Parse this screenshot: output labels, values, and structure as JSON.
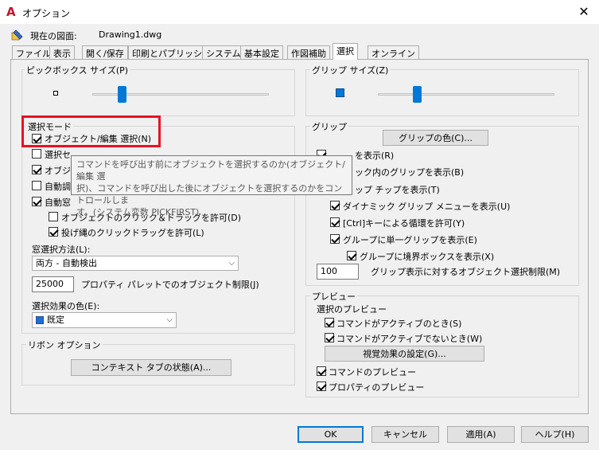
{
  "window": {
    "title": "オプション",
    "close_glyph": "✕"
  },
  "current_drawing": {
    "label": "現在の図面:",
    "value": "Drawing1.dwg"
  },
  "tabs": [
    {
      "label": "ファイル"
    },
    {
      "label": "表示"
    },
    {
      "label": "開く/保存"
    },
    {
      "label": "印刷とパブリッシュ"
    },
    {
      "label": "システム"
    },
    {
      "label": "基本設定"
    },
    {
      "label": "作図補助"
    },
    {
      "label": "選択"
    },
    {
      "label": "オンライン"
    }
  ],
  "active_tab": "選択",
  "pickbox": {
    "title": "ピックボックス サイズ(P)"
  },
  "selection_mode": {
    "title": "選択モード",
    "items": [
      {
        "label": "オブジェクト/編集 選択(N)",
        "checked": true
      },
      {
        "label": "選択セ",
        "checked": false
      },
      {
        "label": "オブジェ",
        "checked": true
      },
      {
        "label": "自動調",
        "checked": false
      },
      {
        "label": "自動窓",
        "checked": true
      },
      {
        "label": "オブジェクトのクリック＆ドラッグを許可(D)",
        "checked": false
      },
      {
        "label": "投げ縄のクリックドラッグを許可(L)",
        "checked": true
      }
    ],
    "window_method_label": "窓選択方法(L):",
    "window_method_value": "両方 - 自動検出",
    "object_limit_value": "25000",
    "object_limit_label": "プロパティ パレットでのオブジェクト制限(J)",
    "effect_color_label": "選択効果の色(E):",
    "effect_color_value": "既定",
    "effect_color_hex": "#1e6fd9"
  },
  "ribbon": {
    "title": "リボン オプション",
    "context_tab_button": "コンテキスト タブの状態(A)..."
  },
  "grip_size": {
    "title": "グリップ サイズ(Z)"
  },
  "grips": {
    "title": "グリップ",
    "color_button": "グリップの色(C)...",
    "items": [
      {
        "label": "を表示(R)",
        "checked": true
      },
      {
        "label": "ック内のグリップを表示(B)",
        "checked": false
      },
      {
        "label": "ップ チップを表示(T)",
        "checked": true
      },
      {
        "label": "ダイナミック グリップ メニューを表示(U)",
        "checked": true
      },
      {
        "label": "[Ctrl]キーによる循環を許可(Y)",
        "checked": true
      },
      {
        "label": "グループに単一グリップを表示(E)",
        "checked": true
      },
      {
        "label": "グループに境界ボックスを表示(X)",
        "checked": true
      }
    ],
    "limit_value": "100",
    "limit_label": "グリップ表示に対するオブジェクト選択制限(M)"
  },
  "preview": {
    "title": "プレビュー",
    "sub_title": "選択のプレビュー",
    "active_label": "コマンドがアクティブのとき(S)",
    "active_checked": true,
    "inactive_label": "コマンドがアクティブでないとき(W)",
    "inactive_checked": true,
    "visual_effect_button": "視覚効果の設定(G)...",
    "command_preview_label": "コマンドのプレビュー",
    "command_preview_checked": true,
    "property_preview_label": "プロパティのプレビュー",
    "property_preview_checked": true
  },
  "tooltip": {
    "line1": "コマンドを呼び出す前にオブジェクトを選択するのか(オブジェクト/編集 選",
    "line2": "択)、コマンドを呼び出した後にオブジェクトを選択するのかをコントロールしま",
    "line3": "す。(システム変数 PICKFIRST)"
  },
  "footer": {
    "ok": "OK",
    "cancel": "キャンセル",
    "apply": "適用(A)",
    "help": "ヘルプ(H)"
  },
  "colors": {
    "highlight": "#e81123",
    "accent": "#0078d7"
  }
}
